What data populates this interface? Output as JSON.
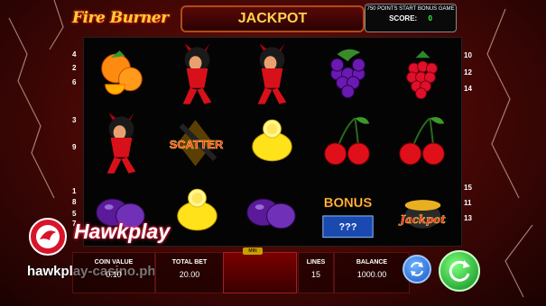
{
  "header": {
    "logo_text": "Fire Burner",
    "jackpot_label": "JACKPOT",
    "bonus_text": "750 POINTS START BONUS GAME",
    "score_label": "SCORE:",
    "score_value": "0"
  },
  "reels": [
    [
      "orange",
      "devil-girl",
      "plum"
    ],
    [
      "devil-girl",
      "scatter",
      "lemon"
    ],
    [
      "devil-girl",
      "lemon",
      "plum"
    ],
    [
      "grapes",
      "cherries",
      "bonus"
    ],
    [
      "raspberry",
      "cherries",
      "jackpot"
    ]
  ],
  "symbol_text": {
    "scatter": "SCATTER",
    "bonus": "BONUS",
    "jackpot": "Jackpot"
  },
  "lines": {
    "left": [
      "4",
      "2",
      "6",
      "3",
      "9",
      "1",
      "8",
      "5",
      "7"
    ],
    "right": [
      "10",
      "12",
      "14",
      "15",
      "11",
      "13"
    ]
  },
  "bottom": {
    "coin_value_label": "COIN VALUE",
    "coin_value": "0.10",
    "total_bet_label": "TOTAL BET",
    "total_bet": "20.00",
    "bet_tab": "MIN",
    "lines_label": "LINES",
    "lines_value": "15",
    "balance_label": "BALANCE",
    "balance_value": "1000.00"
  },
  "overlay": {
    "brand": "Hawkplay",
    "watermark": "hawkplay-casino.ph"
  },
  "colors": {
    "accent_gold": "#ffd24a",
    "score_green": "#3cff4a",
    "spin_green": "#0e8a1e",
    "auto_blue": "#1a56c8"
  }
}
